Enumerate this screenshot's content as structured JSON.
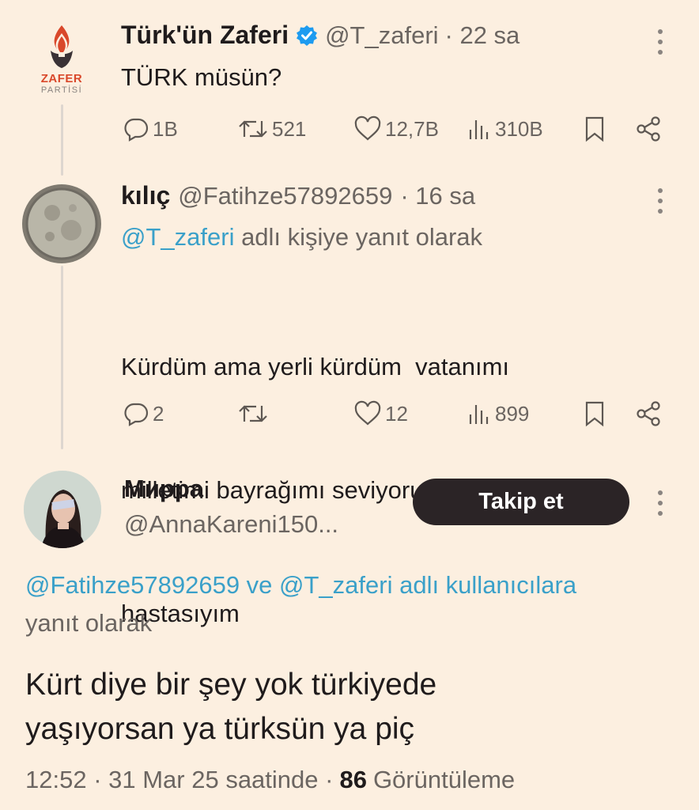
{
  "tweet1": {
    "logo_text_top": "ZAFER",
    "logo_text_bottom": "PARTİSİ",
    "name": "Türk'ün Zaferi",
    "handle": "@T_zaferi",
    "time": "· 22 sa",
    "text": "TÜRK müsün?",
    "replies": "1B",
    "retweets": "521",
    "likes": "12,7B",
    "views": "310B"
  },
  "tweet2": {
    "name": "kılıç",
    "handle": "@Fatihze57892659",
    "time": "· 16 sa",
    "reply_to_handle": "@T_zaferi",
    "reply_to_suffix": " adlı kişiye yanıt olarak",
    "text_line1": "Kürdüm ama yerli kürdüm  vatanımı",
    "text_line2": "milletimi bayrağımı seviyorum hemde",
    "text_line3": "hastasıyım",
    "replies": "2",
    "retweets": "",
    "likes": "12",
    "views": "899"
  },
  "main_tweet": {
    "name": "Мирра",
    "handle": "@AnnaKareni150...",
    "follow_label": "Takip et",
    "reply_to_handles": "@Fatihze57892659 ve @T_zaferi adlı kullanıcılara",
    "reply_to_suffix": "yanıt olarak",
    "text_line1": "Kürt diye bir şey yok türkiyede",
    "text_line2": "yaşıyorsan ya türksün ya piç",
    "time": "12:52 · 31 Mar 25 saatinde ·",
    "views_count": "86",
    "views_label": "Görüntüleme"
  },
  "colors": {
    "background": "#fcefe0",
    "link": "#3aa0c9",
    "verified": "#1d9bf0",
    "button": "#2b2426",
    "logo_red": "#d9482b"
  },
  "icons": [
    "reply-icon",
    "retweet-icon",
    "like-icon",
    "views-icon",
    "bookmark-icon",
    "share-icon",
    "more-icon",
    "verified-badge-icon"
  ]
}
